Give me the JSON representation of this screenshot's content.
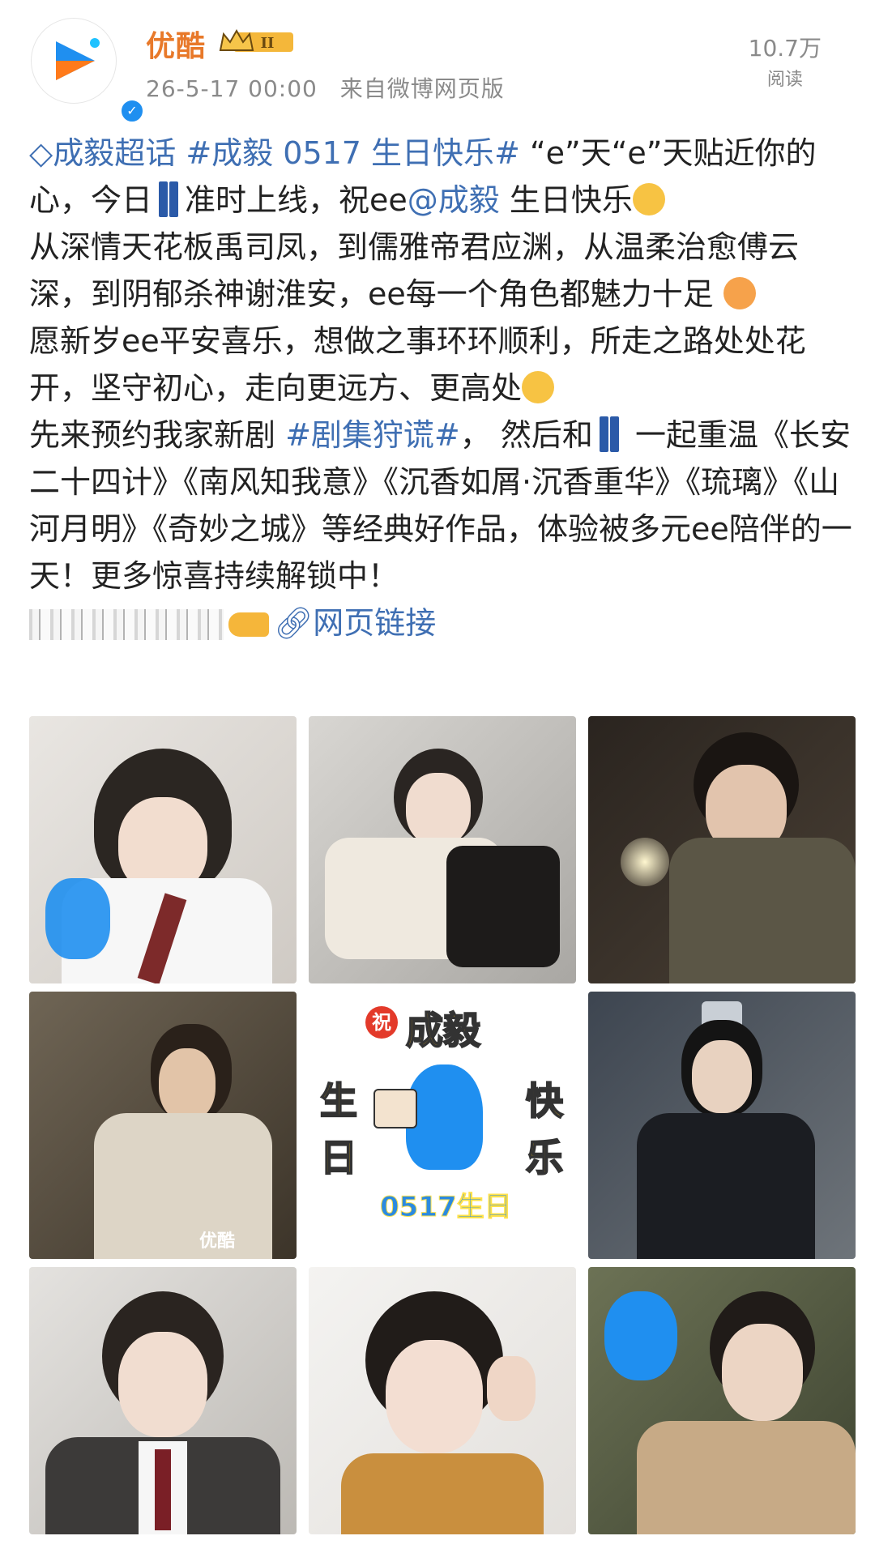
{
  "header": {
    "username": "优酷",
    "vip_level": "II",
    "timestamp": "26-5-17 00:00",
    "source": "来自微博网页版",
    "reads_count": "10.7万",
    "reads_label": "阅读"
  },
  "post": {
    "super_topic": "成毅超话",
    "hashtag": "#成毅 0517 生日快乐#",
    "line1_rest": "“e”天“e”天贴近你的",
    "line2_a": "心，今日",
    "line2_b": "准时上线，祝ee",
    "mention": "@成毅",
    "line2_c": " 生日快乐",
    "para2": "从深情天花板禹司凤，到儒雅帝君应渊，从温柔治愈傅云深，到阴郁杀神谢淮安，ee每一个角色都魅力十足",
    "para3": "愿新岁ee平安喜乐，想做之事环环顺利，所走之路处处花开，坚守初心，走向更远方、更高处",
    "para4_a": "先来预约我家新剧 ",
    "drama_tag": "#剧集狩谎#",
    "para4_b": "， 然后和",
    "para4_c": " 一起重温《长安二十四计》《南风知我意》《沉香如屑·沉香重华》《琉璃》《山河月明》《奇妙之城》等经典好作品，体验被多元ee陪伴的一天！更多惊喜持续解锁中！",
    "web_link": "网页链接"
  },
  "grid": {
    "center_image": {
      "wish": "祝",
      "name": "成毅",
      "left": "生日",
      "right": "快乐",
      "bottom": "0517生日"
    },
    "watermark": "优酷"
  },
  "colors": {
    "link": "#3f6fb3",
    "username": "#e8792a",
    "youku_blue": "#1f8ff0",
    "youku_orange": "#ff7a1a"
  }
}
